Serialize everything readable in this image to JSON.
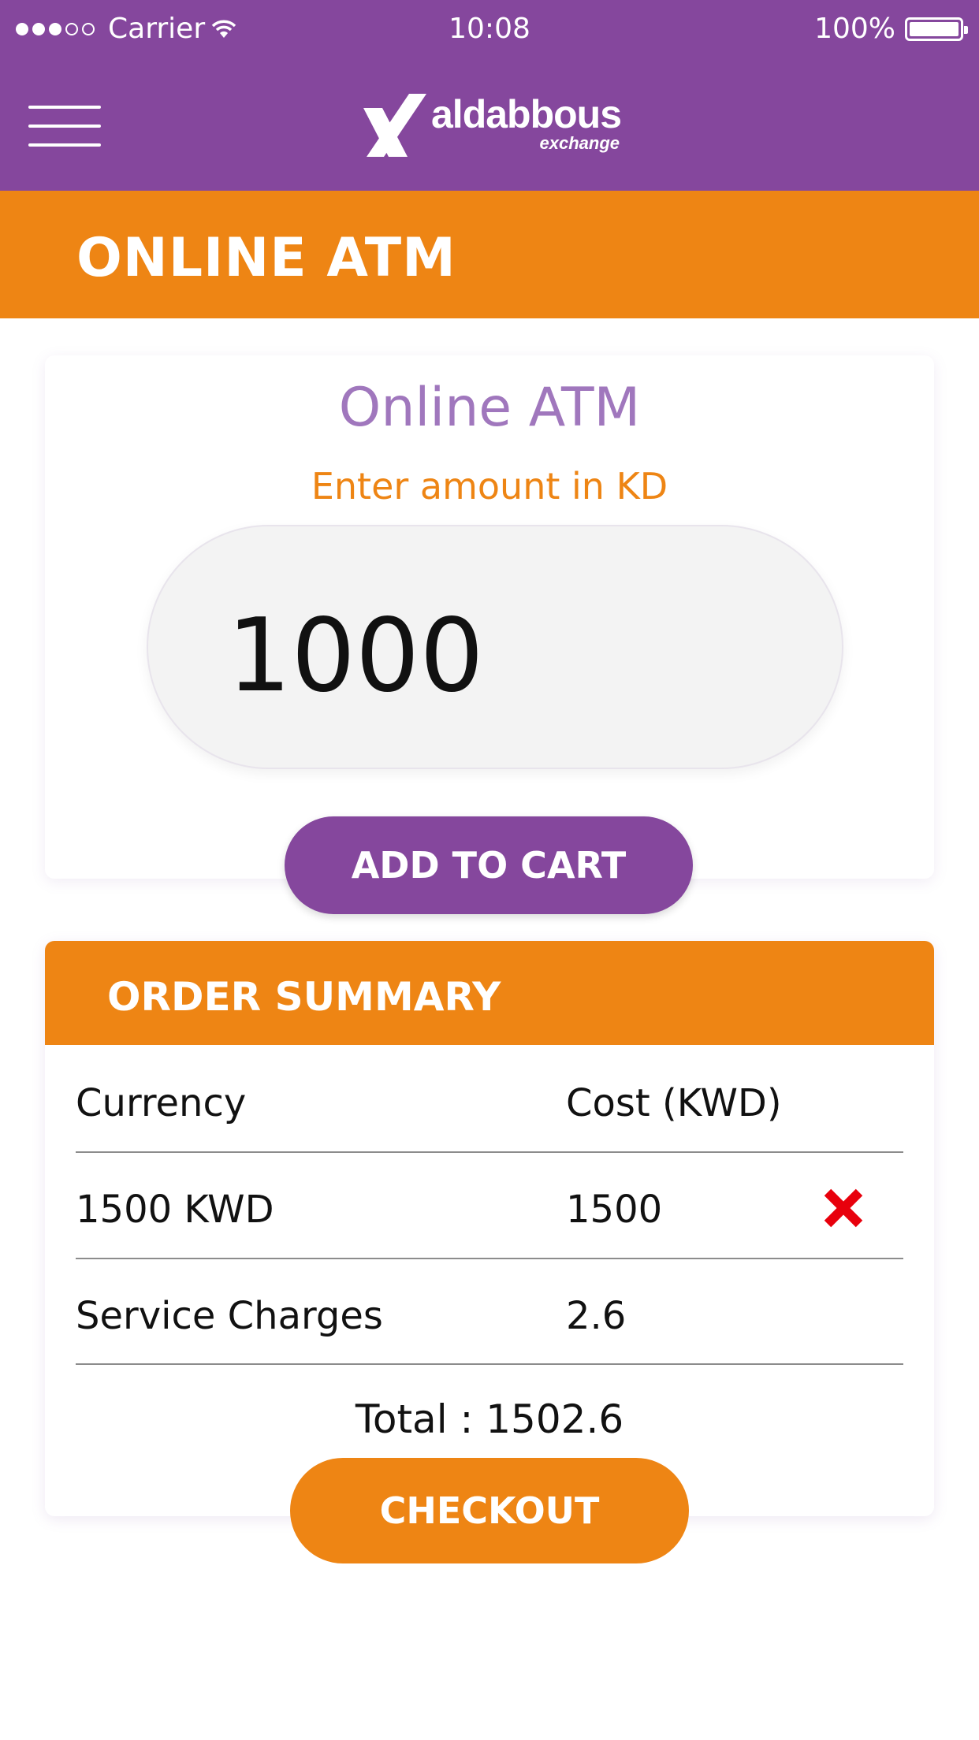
{
  "status_bar": {
    "carrier": "Carrier",
    "time": "10:08",
    "battery": "100%",
    "signal_bars_filled": 3,
    "signal_bars_total": 5,
    "battery_level": 1.0
  },
  "header": {
    "logo_name": "aldabbous",
    "logo_sub": "exchange",
    "menu_icon": "hamburger-icon"
  },
  "page_title": "ONLINE ATM",
  "atm_card": {
    "title": "Online ATM",
    "subtitle": "Enter amount in KD",
    "amount_value": "1000",
    "add_button": "ADD TO CART"
  },
  "order_summary": {
    "heading": "ORDER SUMMARY",
    "columns": [
      "Currency",
      "Cost (KWD)"
    ],
    "rows": [
      {
        "currency": "1500 KWD",
        "cost": "1500",
        "removable": true
      },
      {
        "currency": "Service Charges",
        "cost": "2.6",
        "removable": false
      }
    ],
    "total": "Total : 1502.6",
    "checkout_button": "CHECKOUT"
  },
  "colors": {
    "purple": "#85479d",
    "orange": "#ee8514",
    "light_purple": "#a077bd",
    "delete_red": "#e8000c"
  }
}
